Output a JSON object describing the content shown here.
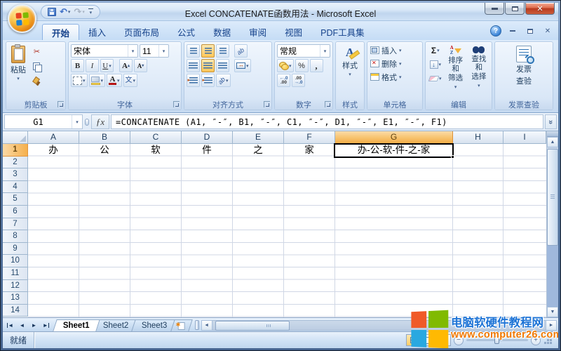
{
  "window": {
    "title": "Excel CONCATENATE函数用法 - Microsoft Excel"
  },
  "icons": {
    "chevron_down": "▾",
    "tri_left": "◄",
    "tri_right": "►",
    "scissors": "✂",
    "undo": "↶",
    "redo": "↷",
    "sigma": "Σ",
    "arrow_down": "↓",
    "help": "?",
    "win_close": "✕",
    "double_chevron": "»",
    "fx": "ƒx",
    "star": "✱",
    "ab": "ab",
    "minus": "−",
    "plus": "+"
  },
  "ribbon": {
    "active_tab": "开始",
    "tabs": [
      "开始",
      "插入",
      "页面布局",
      "公式",
      "数据",
      "审阅",
      "视图",
      "PDF工具集"
    ],
    "groups": {
      "clipboard": {
        "label": "剪贴板",
        "paste": "粘贴"
      },
      "font": {
        "label": "字体",
        "name": "宋体",
        "size": "11",
        "bold": "B",
        "italic": "I",
        "underline": "U",
        "grow": "A",
        "shrink": "A",
        "color": "A",
        "phonetic": "文"
      },
      "alignment": {
        "label": "对齐方式"
      },
      "number": {
        "label": "数字",
        "format": "常规",
        "percent": "%",
        "comma": ",",
        "inc1": "←.0",
        "inc2": ".00",
        "dec1": ".00",
        "dec2": "→.0"
      },
      "styles": {
        "label": "样式",
        "button": "样式"
      },
      "cells": {
        "label": "单元格",
        "insert": "插入",
        "delete": "删除",
        "format": "格式"
      },
      "editing": {
        "label": "编辑",
        "sort_lines": [
          "排序和",
          "筛选"
        ],
        "find_lines": [
          "查找和",
          "选择"
        ]
      },
      "invoice": {
        "label": "发票查验",
        "line1": "发票",
        "line2": "查验"
      }
    }
  },
  "formula_bar": {
    "cell_ref": "G1",
    "formula": "=CONCATENATE (A1, ″-″, B1, ″-″, C1, ″-″, D1, ″-″, E1, ″-″, F1)"
  },
  "grid": {
    "columns": [
      "A",
      "B",
      "C",
      "D",
      "E",
      "F",
      "G",
      "H",
      "I"
    ],
    "selected_column": "G",
    "selected_row": "1",
    "selected_cell": "G1",
    "row_numbers": [
      "1",
      "2",
      "3",
      "4",
      "5",
      "6",
      "7",
      "8",
      "9",
      "10",
      "11",
      "12",
      "13",
      "14"
    ],
    "cells": {
      "A1": "办",
      "B1": "公",
      "C1": "软",
      "D1": "件",
      "E1": "之",
      "F1": "家",
      "G1": "办-公-软-件-之-家"
    }
  },
  "sheet_tabs": {
    "active": "Sheet1",
    "items": [
      "Sheet1",
      "Sheet2",
      "Sheet3"
    ]
  },
  "status_bar": {
    "ready": "就绪"
  },
  "watermark": {
    "name": "电脑软硬件教程网",
    "url": "www.computer26.com"
  },
  "colors": {
    "header_selected": "#F5B04D",
    "ribbon_highlight": "#FFD887",
    "gridline": "#D0D7E5",
    "watermark_blue": "#1E74D6",
    "watermark_orange": "#F07800",
    "logo_colors": [
      "#F05A28",
      "#80BA01",
      "#29A8E0",
      "#FFB902"
    ]
  }
}
